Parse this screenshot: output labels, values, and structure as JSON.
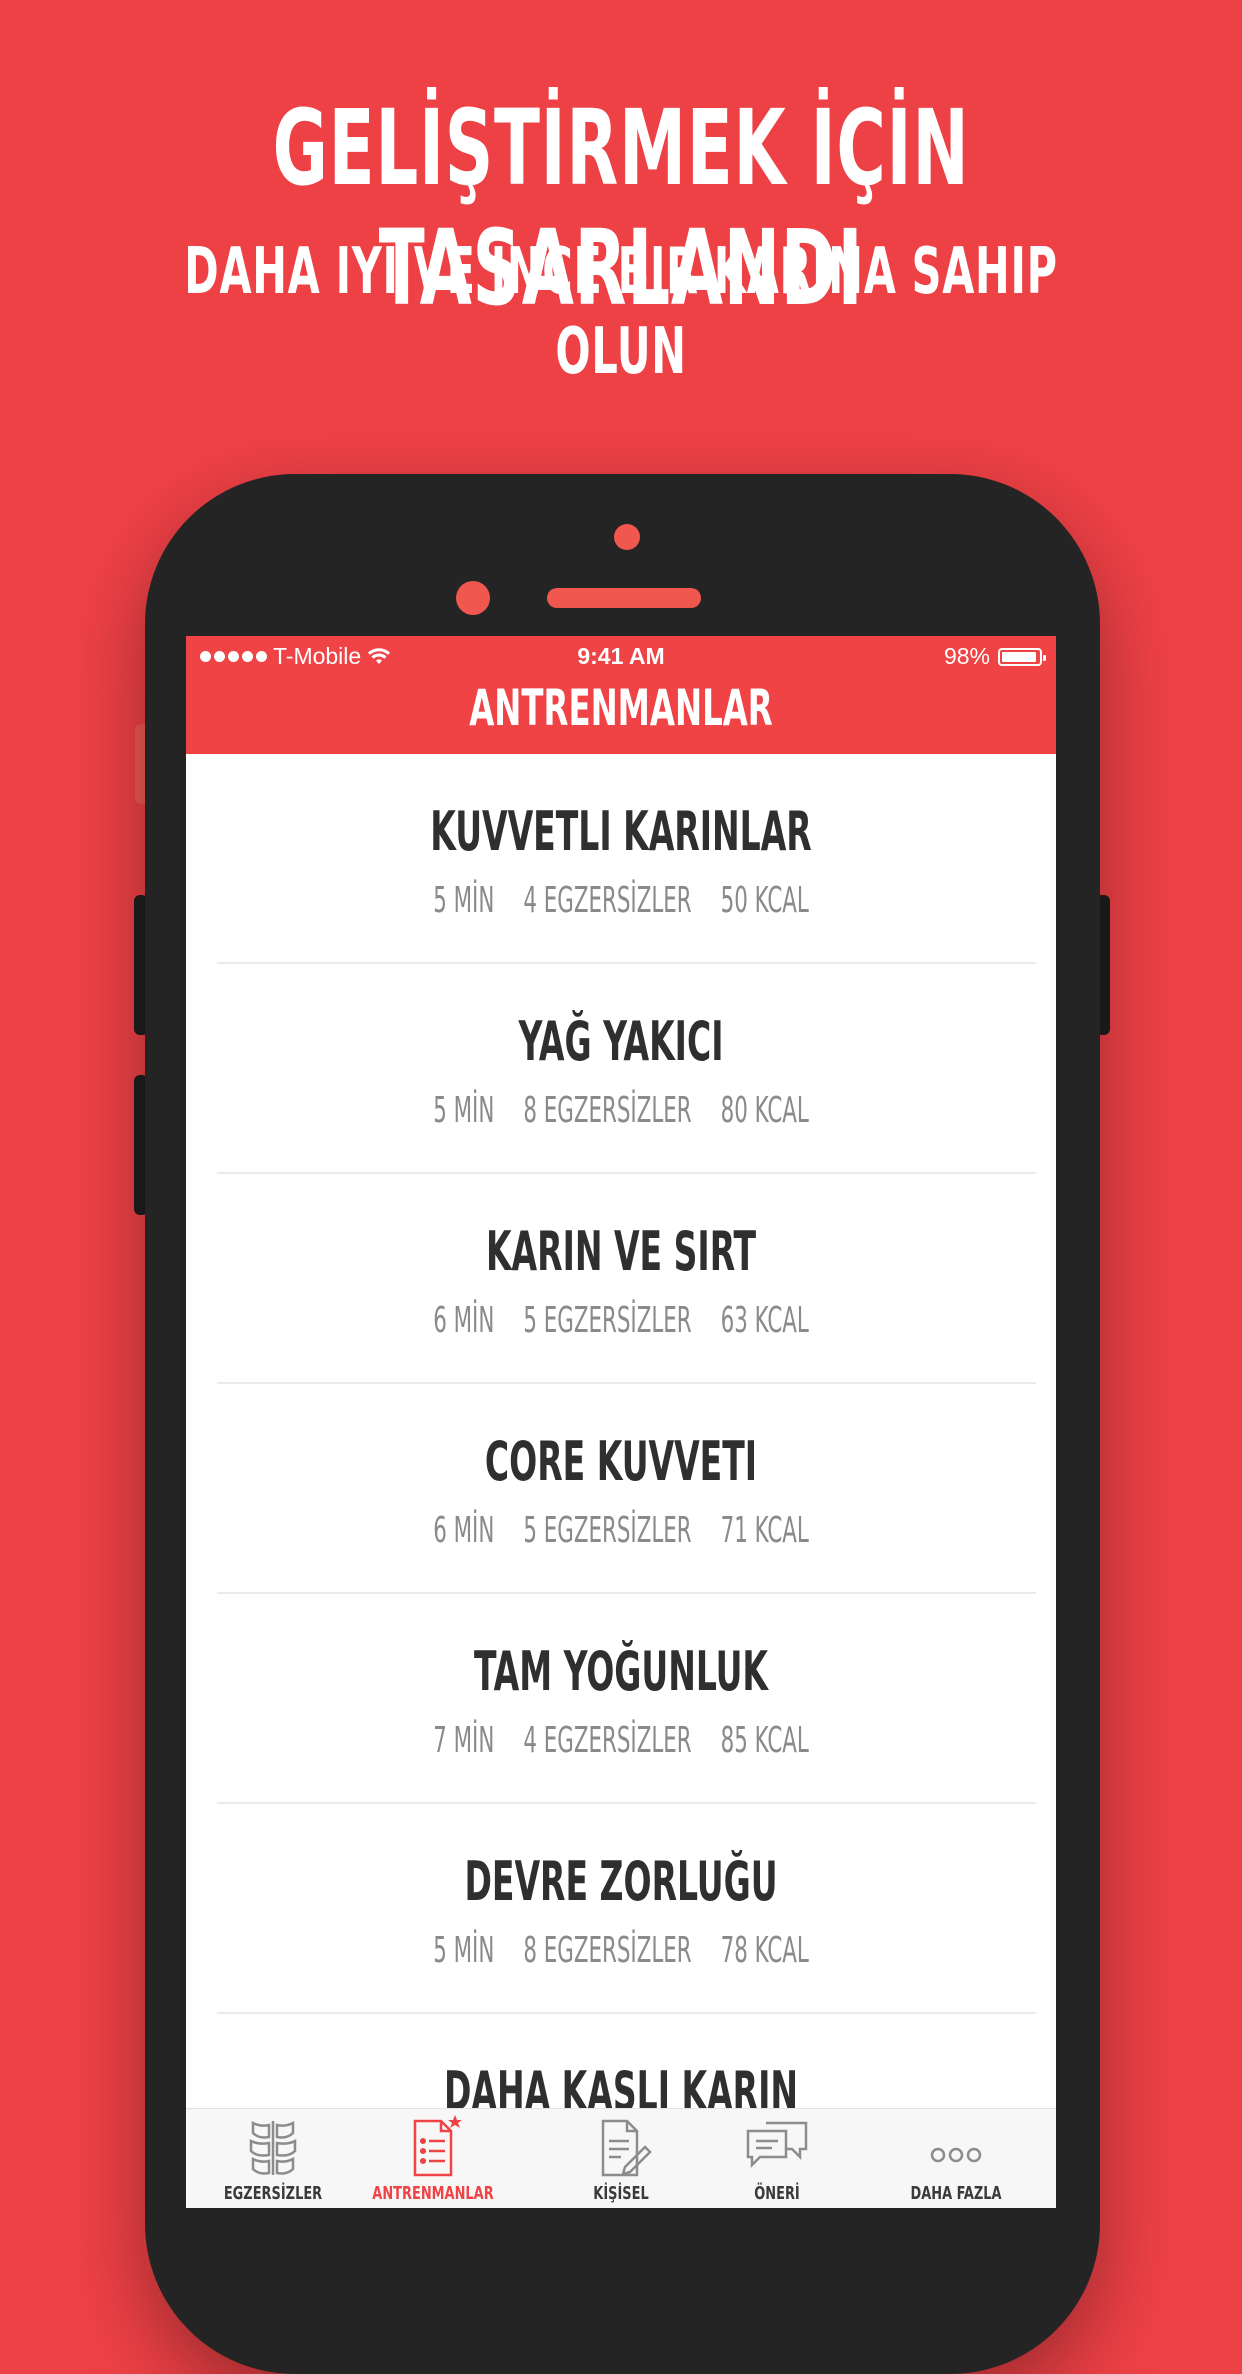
{
  "headline": "GELİŞTİRMEK İÇİN TASARLANDI",
  "subheadline": "DAHA IYI VE INCE BIR KARINA SAHIP OLUN",
  "status_bar": {
    "carrier": "T-Mobile",
    "time": "9:41 AM",
    "battery": "98%"
  },
  "app_title": "ANTRENMANLAR",
  "workouts": [
    {
      "title": "KUVVETLI KARINLAR",
      "duration": "5 MİN",
      "exercises": "4 EGZERSİZLER",
      "calories": "50 KCAL"
    },
    {
      "title": "YAĞ YAKICI",
      "duration": "5 MİN",
      "exercises": "8 EGZERSİZLER",
      "calories": "80 KCAL"
    },
    {
      "title": "KARIN VE SIRT",
      "duration": "6 MİN",
      "exercises": "5 EGZERSİZLER",
      "calories": "63 KCAL"
    },
    {
      "title": "CORE KUVVETI",
      "duration": "6 MİN",
      "exercises": "5 EGZERSİZLER",
      "calories": "71 KCAL"
    },
    {
      "title": "TAM YOĞUNLUK",
      "duration": "7 MİN",
      "exercises": "4 EGZERSİZLER",
      "calories": "85 KCAL"
    },
    {
      "title": "DEVRE ZORLUĞU",
      "duration": "5 MİN",
      "exercises": "8 EGZERSİZLER",
      "calories": "78 KCAL"
    },
    {
      "title": "DAHA KASLI KARIN",
      "duration": "",
      "exercises": "",
      "calories": ""
    }
  ],
  "tabs": [
    {
      "label": "EGZERSİZLER",
      "icon": "abs-icon",
      "active": false
    },
    {
      "label": "ANTRENMANLAR",
      "icon": "workout-list-icon",
      "active": true
    },
    {
      "label": "KİŞİSEL",
      "icon": "personal-edit-icon",
      "active": false
    },
    {
      "label": "ÖNERİ",
      "icon": "chat-bubbles-icon",
      "active": false
    },
    {
      "label": "DAHA FAZLA",
      "icon": "more-dots-icon",
      "active": false
    }
  ],
  "colors": {
    "brand_red": "#ef4346",
    "background_red": "#ee4146",
    "phone_body": "#242424",
    "title_text": "#2f2f2f",
    "meta_text": "#8a8a8a"
  }
}
